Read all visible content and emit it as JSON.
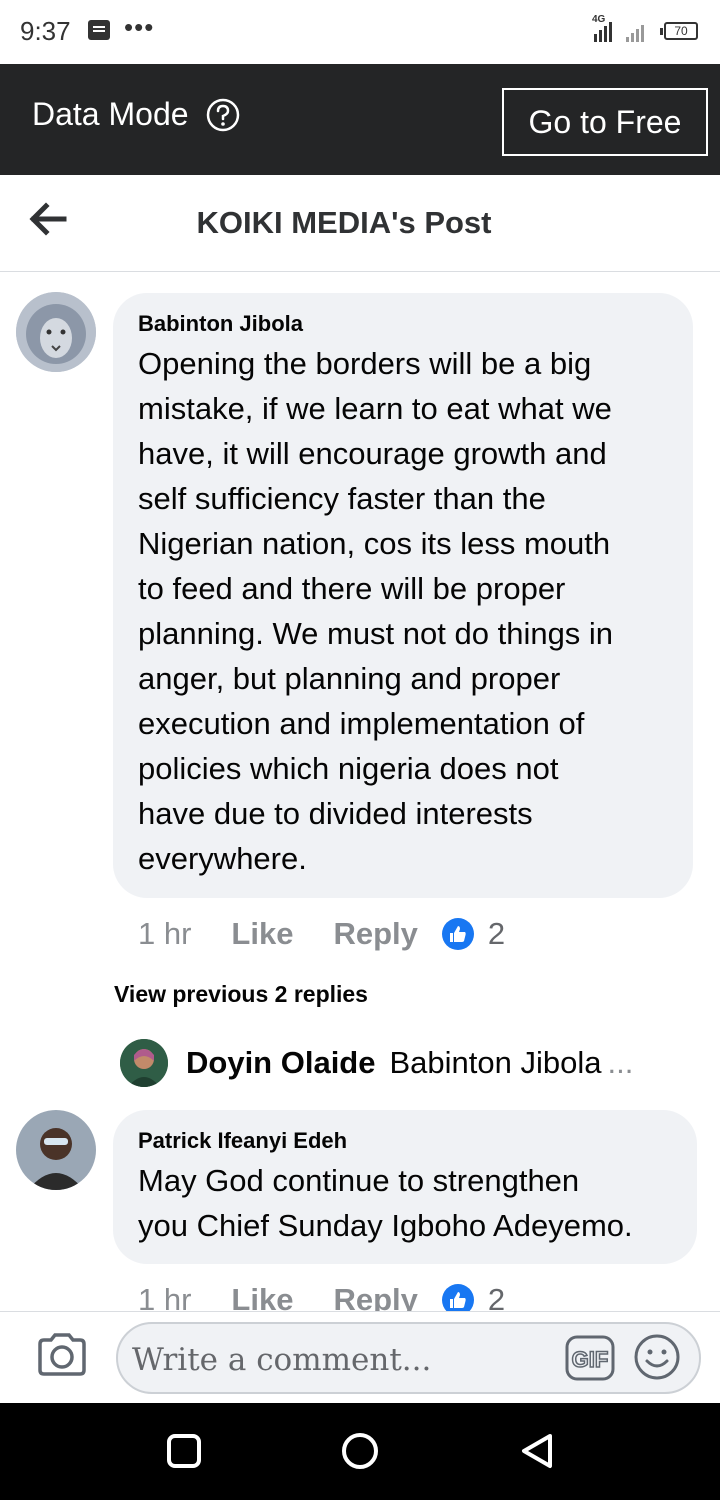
{
  "status_bar": {
    "time": "9:37",
    "dots": "•••",
    "network": "4G",
    "battery": "70"
  },
  "data_mode": {
    "label": "Data Mode",
    "go_free_label": "Go to Free"
  },
  "header": {
    "title": "KOIKI MEDIA's Post"
  },
  "comments": [
    {
      "author": "Babinton Jibola",
      "lines": [
        "Opening the borders will be a big",
        "mistake, if we learn to eat what we",
        "have, it will encourage growth and",
        "self sufficiency faster than the",
        "Nigerian nation, cos its less mouth",
        "to feed and there will be proper",
        "planning.  We must not do things in",
        "anger, but planning and proper",
        "execution and implementation of",
        "policies which nigeria does not",
        "have due to divided interests",
        "everywhere."
      ],
      "time": "1 hr",
      "like_label": "Like",
      "reply_label": "Reply",
      "reaction_count": "2"
    },
    {
      "author": "Patrick Ifeanyi Edeh",
      "lines": [
        "May God continue to strengthen",
        "you Chief Sunday Igboho Adeyemo."
      ],
      "time": "1 hr",
      "like_label": "Like",
      "reply_label": "Reply",
      "reaction_count": "2"
    }
  ],
  "replies": {
    "view_previous": "View previous 2 replies",
    "last_reply": {
      "author": "Doyin Olaide",
      "preview": "Babinton Jibola",
      "ellipsis": "..."
    }
  },
  "composer": {
    "placeholder": "Write a comment...",
    "gif_label": "GIF"
  },
  "colors": {
    "data_mode_bg": "#242526",
    "bubble_bg": "#f0f2f5",
    "like_blue": "#1877f2",
    "nav_bg": "#000000"
  }
}
